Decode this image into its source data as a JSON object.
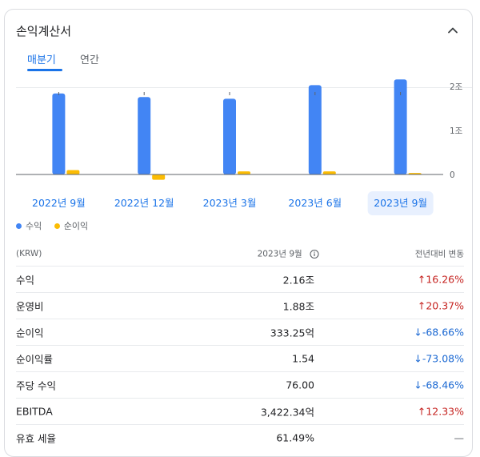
{
  "card": {
    "title": "손익계산서"
  },
  "tabs": [
    {
      "label": "매분기",
      "active": true
    },
    {
      "label": "연간",
      "active": false
    }
  ],
  "chart_data": {
    "type": "bar",
    "categories": [
      "2022년 9월",
      "2022년 12월",
      "2023년 3월",
      "2023년 6월",
      "2023년 9월"
    ],
    "series": [
      {
        "name": "수익",
        "color": "#4285f4",
        "values": [
          1.84,
          1.76,
          1.72,
          2.03,
          2.16
        ]
      },
      {
        "name": "순이익",
        "color": "#fbbc04",
        "values": [
          0.1,
          -0.12,
          0.07,
          0.07,
          0.033
        ]
      }
    ],
    "y_tick_labels": [
      "2조",
      "1조",
      "0"
    ],
    "y_ticks": [
      2,
      1,
      0
    ],
    "ylim": [
      -0.2,
      2.2
    ],
    "selected_index": 4
  },
  "table": {
    "header": {
      "col1": "(KRW)",
      "col2": "2023년 9월",
      "col3": "전년대비 변동"
    },
    "rows": [
      {
        "label": "수익",
        "value": "2.16조",
        "change": "↑16.26%",
        "dir": "up"
      },
      {
        "label": "운영비",
        "value": "1.88조",
        "change": "↑20.37%",
        "dir": "up"
      },
      {
        "label": "순이익",
        "value": "333.25억",
        "change": "↓-68.66%",
        "dir": "down"
      },
      {
        "label": "순이익률",
        "value": "1.54",
        "change": "↓-73.08%",
        "dir": "down"
      },
      {
        "label": "주당 수익",
        "value": "76.00",
        "change": "↓-68.46%",
        "dir": "down"
      },
      {
        "label": "EBITDA",
        "value": "3,422.34억",
        "change": "↑12.33%",
        "dir": "up"
      },
      {
        "label": "유효 세율",
        "value": "61.49%",
        "change": "—",
        "dir": "neutral"
      }
    ]
  },
  "icons": {
    "collapse": "chevron-up-icon",
    "info": "info-icon"
  }
}
